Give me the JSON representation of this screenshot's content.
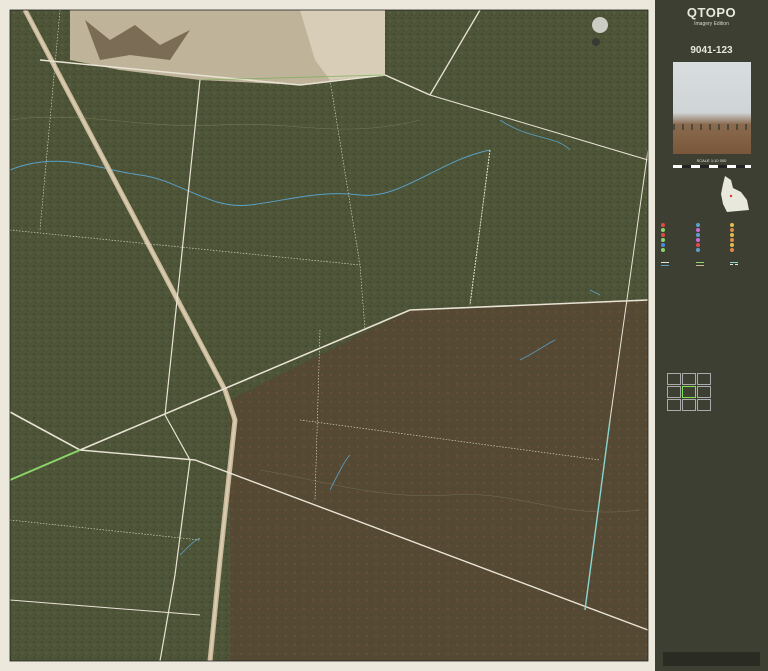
{
  "map": {
    "locality_label": "",
    "colors": {
      "terrain": "#4d5437",
      "terrain_dark": "#5b4a33",
      "road": "#e9e3d4",
      "track": "#c9b99a",
      "creek": "#5aa0c8",
      "boundary_green": "#8bd66b",
      "boundary_cyan": "#8ad5d0"
    }
  },
  "legend": {
    "brand": "QTOPO",
    "edition": "Imagery Edition",
    "sheet_number": "9041-123",
    "scale": "SCALE 1:10 000"
  }
}
